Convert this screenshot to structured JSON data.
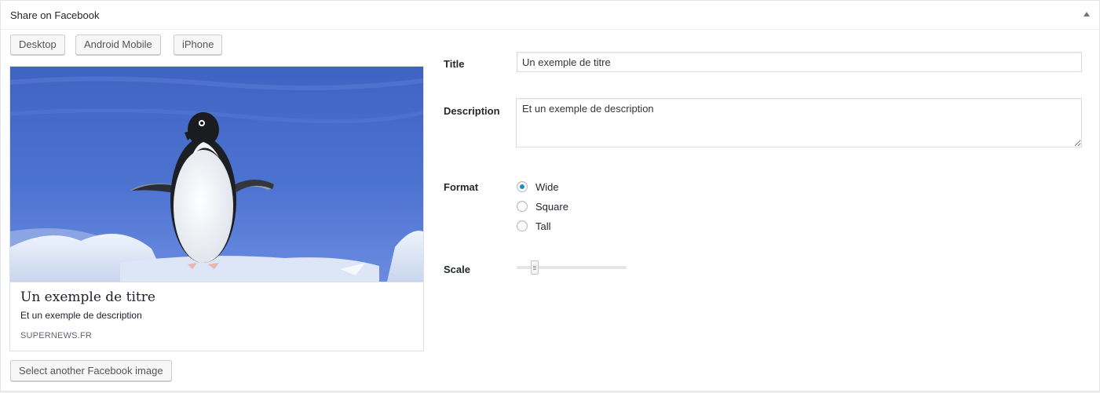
{
  "panel": {
    "title": "Share on Facebook"
  },
  "device_tabs": [
    "Desktop",
    "Android Mobile",
    "iPhone"
  ],
  "preview": {
    "title": "Un exemple de titre",
    "description": "Et un exemple de description",
    "domain": "SUPERNEWS.FR"
  },
  "form": {
    "title_label": "Title",
    "title_value": "Un exemple de titre",
    "description_label": "Description",
    "description_value": "Et un exemple de description",
    "format_label": "Format",
    "format_options": [
      "Wide",
      "Square",
      "Tall"
    ],
    "format_selected": "Wide",
    "scale_label": "Scale",
    "scale_level": 0.16
  },
  "select_image_label": "Select another Facebook image",
  "colors": {
    "accent": "#1e8cbe",
    "sky": "#4a6fc9"
  }
}
